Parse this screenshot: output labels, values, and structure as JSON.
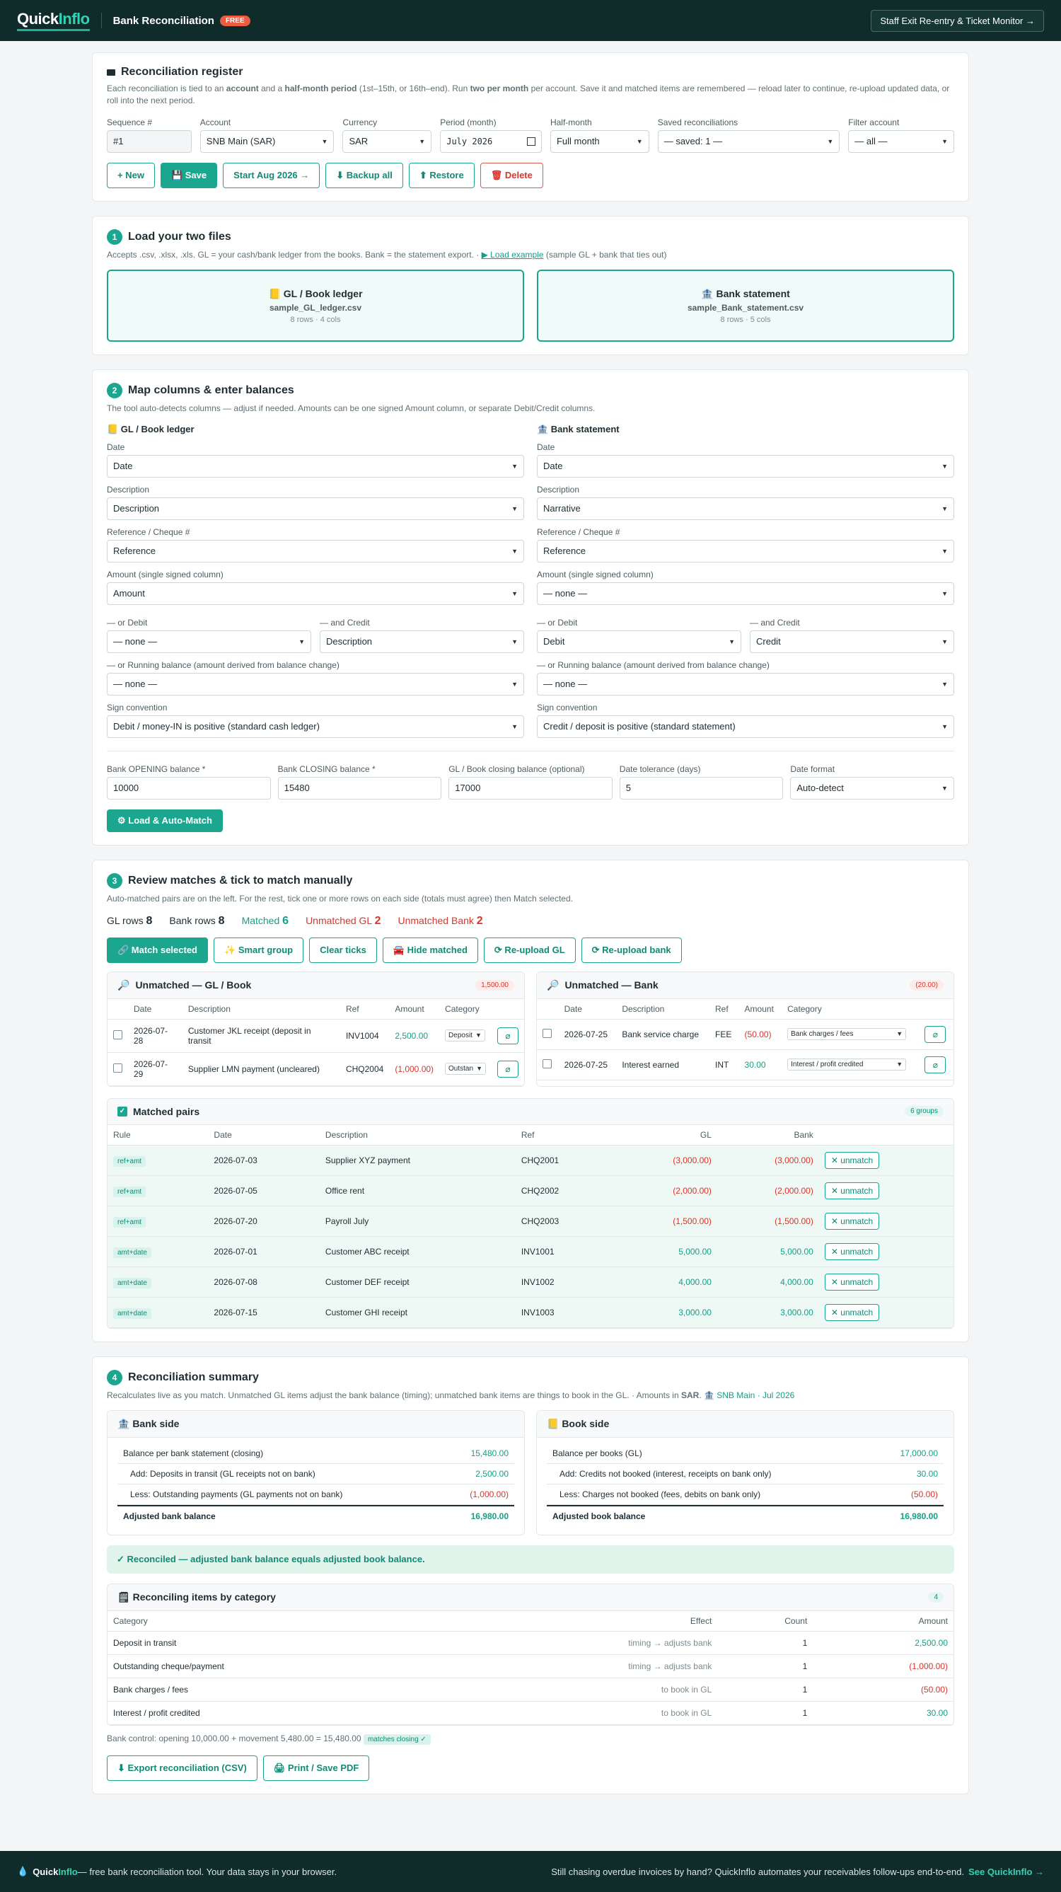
{
  "header": {
    "logo_a": "Quick",
    "logo_b": "Inflo",
    "title": "Bank Reconciliation",
    "badge": "FREE",
    "staff_btn": "Staff Exit Re-entry & Ticket Monitor →"
  },
  "register": {
    "title": "Reconciliation register",
    "desc_a": "Each reconciliation is tied to an ",
    "desc_b": "account",
    "desc_c": " and a ",
    "desc_d": "half-month period",
    "desc_e": " (1st–15th, or 16th–end). Run ",
    "desc_f": "two per month",
    "desc_g": " per account. Save it and matched items are remembered — reload later to continue, re-upload updated data, or roll into the next period.",
    "seq_label": "Sequence #",
    "seq_value": "#1",
    "account_label": "Account",
    "account_value": "SNB Main (SAR)",
    "currency_label": "Currency",
    "currency_value": "SAR",
    "period_label": "Period (month)",
    "period_value": "July 2026",
    "half_label": "Half-month",
    "half_value": "Full month",
    "saved_label": "Saved reconciliations",
    "saved_value": "— saved: 1 —",
    "filter_label": "Filter account",
    "filter_value": "— all —",
    "btn_new": "+ New",
    "btn_save": "💾 Save",
    "btn_start": "Start Aug 2026 →",
    "btn_backup": "⬇ Backup all",
    "btn_restore": "⬆ Restore",
    "btn_delete": "🗑 Delete"
  },
  "step1": {
    "num": "1",
    "title": "Load your two files",
    "sub_a": "Accepts .csv, .xlsx, .xls. GL = your cash/bank ledger from the books. Bank = the statement export. · ",
    "sub_link": "▶ Load example",
    "sub_b": " (sample GL + bank that ties out)",
    "gl_title": "📒 GL / Book ledger",
    "gl_file": "sample_GL_ledger.csv",
    "gl_meta": "8 rows · 4 cols",
    "bank_title": "🏦 Bank statement",
    "bank_file": "sample_Bank_statement.csv",
    "bank_meta": "8 rows · 5 cols"
  },
  "step2": {
    "num": "2",
    "title": "Map columns & enter balances",
    "sub": "The tool auto-detects columns — adjust if needed. Amounts can be one signed Amount column, or separate Debit/Credit columns.",
    "gl": {
      "title": "📒 GL / Book ledger",
      "date": "Date",
      "desc": "Description",
      "ref": "Reference",
      "amount": "Amount",
      "debit": "— none —",
      "credit": "Description",
      "running": "— none —",
      "sign": "Debit / money-IN is positive (standard cash ledger)"
    },
    "bank": {
      "title": "🏦 Bank statement",
      "date": "Date",
      "desc": "Narrative",
      "ref": "Reference",
      "amount": "— none —",
      "debit": "Debit",
      "credit": "Credit",
      "running": "— none —",
      "sign": "Credit / deposit is positive (standard statement)"
    },
    "labels": {
      "date": "Date",
      "desc": "Description",
      "ref": "Reference / Cheque #",
      "amount": "Amount (single signed column)",
      "debit": "— or Debit",
      "credit": "— and Credit",
      "running": "— or Running balance (amount derived from balance change)",
      "sign": "Sign convention"
    },
    "open_label": "Bank OPENING balance *",
    "open_value": "10000",
    "close_label": "Bank CLOSING balance *",
    "close_value": "15480",
    "glclose_label": "GL / Book closing balance (optional)",
    "glclose_value": "17000",
    "tol_label": "Date tolerance (days)",
    "tol_value": "5",
    "fmt_label": "Date format",
    "fmt_value": "Auto-detect",
    "btn": "⚙ Load & Auto-Match"
  },
  "step3": {
    "num": "3",
    "title": "Review matches & tick to match manually",
    "sub": "Auto-matched pairs are on the left. For the rest, tick one or more rows on each side (totals must agree) then Match selected.",
    "s_gl": "GL rows",
    "s_gl_v": "8",
    "s_bank": "Bank rows",
    "s_bank_v": "8",
    "s_match": "Matched",
    "s_match_v": "6",
    "s_ugl": "Unmatched GL",
    "s_ugl_v": "2",
    "s_ubank": "Unmatched Bank",
    "s_ubank_v": "2",
    "btn_match": "🔗 Match selected",
    "btn_smart": "✨ Smart group",
    "btn_clear": "Clear ticks",
    "btn_hide": "🚘 Hide matched",
    "btn_regl": "⟳ Re-upload GL",
    "btn_rebank": "⟳ Re-upload bank",
    "ugl_title": "Unmatched — GL / Book",
    "ugl_pill": "1,500.00",
    "ubank_title": "Unmatched — Bank",
    "ubank_pill": "(20.00)",
    "cols": {
      "date": "Date",
      "desc": "Description",
      "ref": "Ref",
      "amount": "Amount",
      "cat": "Category"
    },
    "ugl_rows": [
      {
        "date": "2026-07-28",
        "desc": "Customer JKL receipt (deposit in transit",
        "ref": "INV1004",
        "amount": "2,500.00",
        "cat": "Deposit"
      },
      {
        "date": "2026-07-29",
        "desc": "Supplier LMN payment (uncleared)",
        "ref": "CHQ2004",
        "amount": "(1,000.00)",
        "cat": "Outstan"
      }
    ],
    "ubank_rows": [
      {
        "date": "2026-07-25",
        "desc": "Bank service charge",
        "ref": "FEE",
        "amount": "(50.00)",
        "cat": "Bank charges / fees"
      },
      {
        "date": "2026-07-25",
        "desc": "Interest earned",
        "ref": "INT",
        "amount": "30.00",
        "cat": "Interest / profit credited"
      }
    ],
    "matched_title": "Matched pairs",
    "matched_pill": "6 groups",
    "mcols": {
      "rule": "Rule",
      "date": "Date",
      "desc": "Description",
      "ref": "Ref",
      "gl": "GL",
      "bank": "Bank"
    },
    "unmatch": "✕ unmatch",
    "matched": [
      {
        "rule": "ref+amt",
        "date": "2026-07-03",
        "desc": "Supplier XYZ payment",
        "ref": "CHQ2001",
        "gl": "(3,000.00)",
        "bank": "(3,000.00)"
      },
      {
        "rule": "ref+amt",
        "date": "2026-07-05",
        "desc": "Office rent",
        "ref": "CHQ2002",
        "gl": "(2,000.00)",
        "bank": "(2,000.00)"
      },
      {
        "rule": "ref+amt",
        "date": "2026-07-20",
        "desc": "Payroll July",
        "ref": "CHQ2003",
        "gl": "(1,500.00)",
        "bank": "(1,500.00)"
      },
      {
        "rule": "amt+date",
        "date": "2026-07-01",
        "desc": "Customer ABC receipt",
        "ref": "INV1001",
        "gl": "5,000.00",
        "bank": "5,000.00"
      },
      {
        "rule": "amt+date",
        "date": "2026-07-08",
        "desc": "Customer DEF receipt",
        "ref": "INV1002",
        "gl": "4,000.00",
        "bank": "4,000.00"
      },
      {
        "rule": "amt+date",
        "date": "2026-07-15",
        "desc": "Customer GHI receipt",
        "ref": "INV1003",
        "gl": "3,000.00",
        "bank": "3,000.00"
      }
    ]
  },
  "step4": {
    "num": "4",
    "title": "Reconciliation summary",
    "sub_a": "Recalculates live as you match. Unmatched GL items adjust the bank balance (timing); unmatched bank items are things to book in the GL. · Amounts in ",
    "sub_cur": "SAR",
    "sub_b": ". 🏦 ",
    "sub_acct": "SNB Main · Jul 2026",
    "bank_title": "🏦 Bank side",
    "book_title": "📒 Book side",
    "bank_lines": [
      {
        "label": "Balance per bank statement (closing)",
        "value": "15,480.00"
      },
      {
        "label": "Add: Deposits in transit (GL receipts not on bank)",
        "value": "2,500.00"
      },
      {
        "label": "Less: Outstanding payments (GL payments not on bank)",
        "value": "(1,000.00)"
      }
    ],
    "bank_total_label": "Adjusted bank balance",
    "bank_total": "16,980.00",
    "book_lines": [
      {
        "label": "Balance per books (GL)",
        "value": "17,000.00"
      },
      {
        "label": "Add: Credits not booked (interest, receipts on bank only)",
        "value": "30.00"
      },
      {
        "label": "Less: Charges not booked (fees, debits on bank only)",
        "value": "(50.00)"
      }
    ],
    "book_total_label": "Adjusted book balance",
    "book_total": "16,980.00",
    "ok": "✓ Reconciled — adjusted bank balance equals adjusted book balance.",
    "cat_title": "🗒 Reconciling items by category",
    "cat_pill": "4",
    "ccols": {
      "cat": "Category",
      "effect": "Effect",
      "count": "Count",
      "amount": "Amount"
    },
    "cats": [
      {
        "cat": "Deposit in transit",
        "effect": "timing → adjusts bank",
        "count": "1",
        "amount": "2,500.00"
      },
      {
        "cat": "Outstanding cheque/payment",
        "effect": "timing → adjusts bank",
        "count": "1",
        "amount": "(1,000.00)"
      },
      {
        "cat": "Bank charges / fees",
        "effect": "to book in GL",
        "count": "1",
        "amount": "(50.00)"
      },
      {
        "cat": "Interest / profit credited",
        "effect": "to book in GL",
        "count": "1",
        "amount": "30.00"
      }
    ],
    "control": "Bank control: opening 10,000.00 + movement 5,480.00 = 15,480.00",
    "control_badge": "matches closing ✓",
    "btn_csv": "⬇ Export reconciliation (CSV)",
    "btn_pdf": "🖨 Print / Save PDF"
  },
  "footer": {
    "brand_a": "Quick",
    "brand_b": "Inflo",
    "text": " — free bank reconciliation tool. Your data stays in your browser.",
    "promo": "Still chasing overdue invoices by hand? QuickInflo automates your receivables follow-ups end-to-end.",
    "link": "See QuickInflo →"
  }
}
